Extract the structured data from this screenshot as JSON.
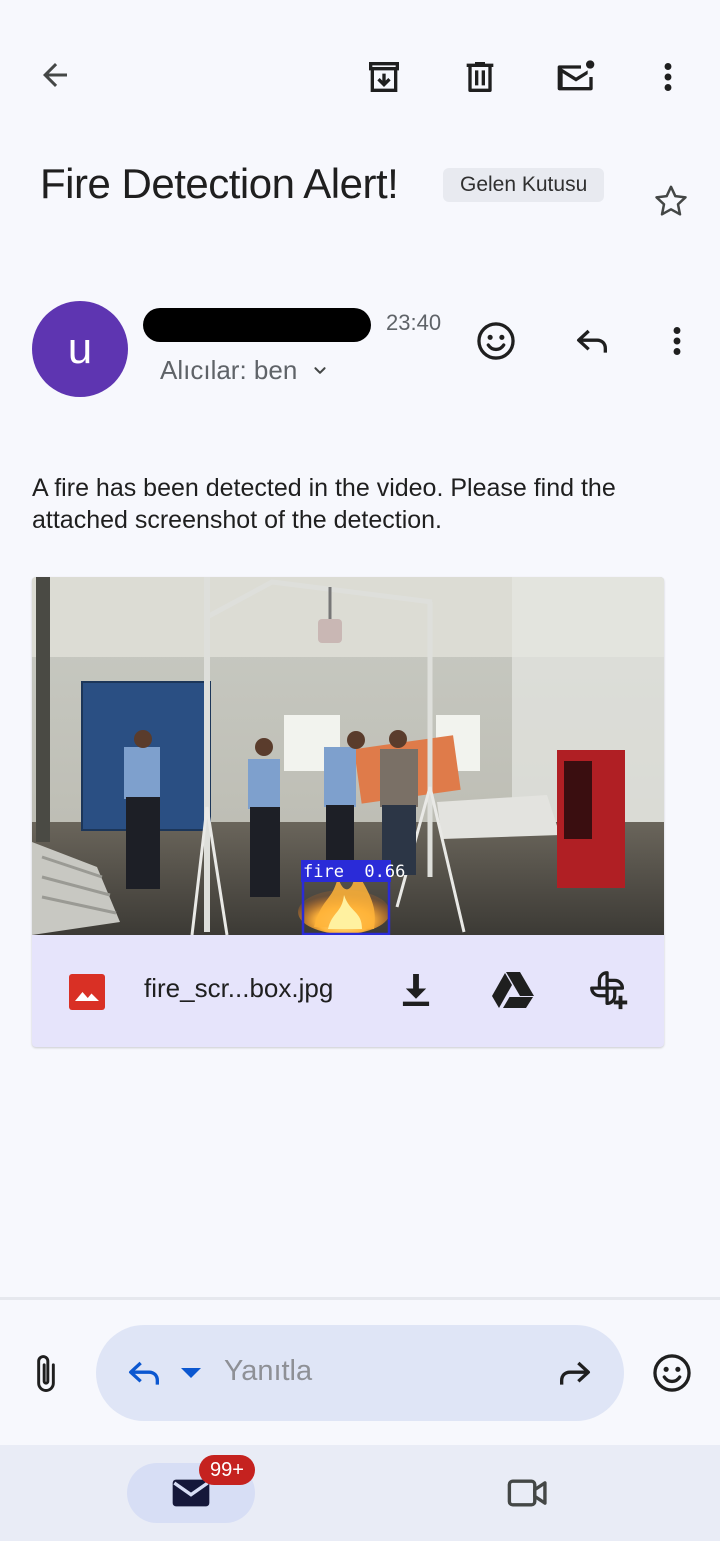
{
  "toolbar": {
    "back_icon": "arrow-back-icon",
    "archive_icon": "archive-icon",
    "delete_icon": "trash-icon",
    "mark_unread_icon": "mark-unread-mail-icon",
    "more_icon": "more-vert-icon"
  },
  "message": {
    "subject": "Fire Detection Alert!",
    "label": "Gelen Kutusu",
    "star_icon": "star-outline-icon",
    "sender_initial": "u",
    "time": "23:40",
    "recipients": "Alıcılar: ben",
    "body": "A fire has been detected in the video. Please find the attached screenshot of the detection."
  },
  "attachment": {
    "detection_label": "fire  0.66",
    "filename": "fire_scr...box.jpg",
    "file_icon": "image-file-icon",
    "download_icon": "download-icon",
    "drive_icon": "google-drive-icon",
    "photos_icon": "add-to-photos-icon"
  },
  "reply_bar": {
    "placeholder": "Yanıtla"
  },
  "bottom_nav": {
    "mail_badge": "99+"
  },
  "colors": {
    "background": "#f7f8fd",
    "avatar": "#5e35b1",
    "attachment_card": "#e6e4fb",
    "badge": "#c5221f",
    "reply_accent": "#0b57d0"
  }
}
